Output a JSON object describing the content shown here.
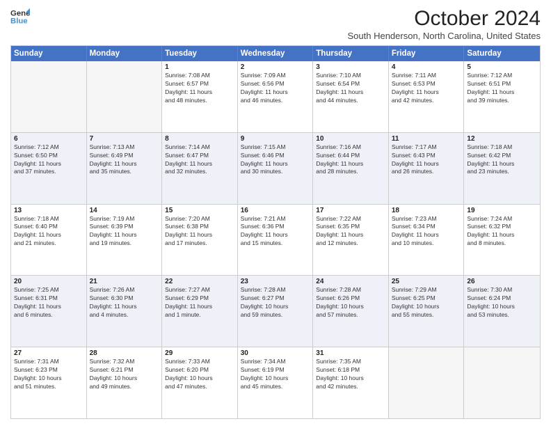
{
  "logo": {
    "line1": "General",
    "line2": "Blue"
  },
  "title": "October 2024",
  "subtitle": "South Henderson, North Carolina, United States",
  "header_days": [
    "Sunday",
    "Monday",
    "Tuesday",
    "Wednesday",
    "Thursday",
    "Friday",
    "Saturday"
  ],
  "rows": [
    {
      "alt": false,
      "cells": [
        {
          "day": "",
          "lines": []
        },
        {
          "day": "",
          "lines": []
        },
        {
          "day": "1",
          "lines": [
            "Sunrise: 7:08 AM",
            "Sunset: 6:57 PM",
            "Daylight: 11 hours",
            "and 48 minutes."
          ]
        },
        {
          "day": "2",
          "lines": [
            "Sunrise: 7:09 AM",
            "Sunset: 6:56 PM",
            "Daylight: 11 hours",
            "and 46 minutes."
          ]
        },
        {
          "day": "3",
          "lines": [
            "Sunrise: 7:10 AM",
            "Sunset: 6:54 PM",
            "Daylight: 11 hours",
            "and 44 minutes."
          ]
        },
        {
          "day": "4",
          "lines": [
            "Sunrise: 7:11 AM",
            "Sunset: 6:53 PM",
            "Daylight: 11 hours",
            "and 42 minutes."
          ]
        },
        {
          "day": "5",
          "lines": [
            "Sunrise: 7:12 AM",
            "Sunset: 6:51 PM",
            "Daylight: 11 hours",
            "and 39 minutes."
          ]
        }
      ]
    },
    {
      "alt": true,
      "cells": [
        {
          "day": "6",
          "lines": [
            "Sunrise: 7:12 AM",
            "Sunset: 6:50 PM",
            "Daylight: 11 hours",
            "and 37 minutes."
          ]
        },
        {
          "day": "7",
          "lines": [
            "Sunrise: 7:13 AM",
            "Sunset: 6:49 PM",
            "Daylight: 11 hours",
            "and 35 minutes."
          ]
        },
        {
          "day": "8",
          "lines": [
            "Sunrise: 7:14 AM",
            "Sunset: 6:47 PM",
            "Daylight: 11 hours",
            "and 32 minutes."
          ]
        },
        {
          "day": "9",
          "lines": [
            "Sunrise: 7:15 AM",
            "Sunset: 6:46 PM",
            "Daylight: 11 hours",
            "and 30 minutes."
          ]
        },
        {
          "day": "10",
          "lines": [
            "Sunrise: 7:16 AM",
            "Sunset: 6:44 PM",
            "Daylight: 11 hours",
            "and 28 minutes."
          ]
        },
        {
          "day": "11",
          "lines": [
            "Sunrise: 7:17 AM",
            "Sunset: 6:43 PM",
            "Daylight: 11 hours",
            "and 26 minutes."
          ]
        },
        {
          "day": "12",
          "lines": [
            "Sunrise: 7:18 AM",
            "Sunset: 6:42 PM",
            "Daylight: 11 hours",
            "and 23 minutes."
          ]
        }
      ]
    },
    {
      "alt": false,
      "cells": [
        {
          "day": "13",
          "lines": [
            "Sunrise: 7:18 AM",
            "Sunset: 6:40 PM",
            "Daylight: 11 hours",
            "and 21 minutes."
          ]
        },
        {
          "day": "14",
          "lines": [
            "Sunrise: 7:19 AM",
            "Sunset: 6:39 PM",
            "Daylight: 11 hours",
            "and 19 minutes."
          ]
        },
        {
          "day": "15",
          "lines": [
            "Sunrise: 7:20 AM",
            "Sunset: 6:38 PM",
            "Daylight: 11 hours",
            "and 17 minutes."
          ]
        },
        {
          "day": "16",
          "lines": [
            "Sunrise: 7:21 AM",
            "Sunset: 6:36 PM",
            "Daylight: 11 hours",
            "and 15 minutes."
          ]
        },
        {
          "day": "17",
          "lines": [
            "Sunrise: 7:22 AM",
            "Sunset: 6:35 PM",
            "Daylight: 11 hours",
            "and 12 minutes."
          ]
        },
        {
          "day": "18",
          "lines": [
            "Sunrise: 7:23 AM",
            "Sunset: 6:34 PM",
            "Daylight: 11 hours",
            "and 10 minutes."
          ]
        },
        {
          "day": "19",
          "lines": [
            "Sunrise: 7:24 AM",
            "Sunset: 6:32 PM",
            "Daylight: 11 hours",
            "and 8 minutes."
          ]
        }
      ]
    },
    {
      "alt": true,
      "cells": [
        {
          "day": "20",
          "lines": [
            "Sunrise: 7:25 AM",
            "Sunset: 6:31 PM",
            "Daylight: 11 hours",
            "and 6 minutes."
          ]
        },
        {
          "day": "21",
          "lines": [
            "Sunrise: 7:26 AM",
            "Sunset: 6:30 PM",
            "Daylight: 11 hours",
            "and 4 minutes."
          ]
        },
        {
          "day": "22",
          "lines": [
            "Sunrise: 7:27 AM",
            "Sunset: 6:29 PM",
            "Daylight: 11 hours",
            "and 1 minute."
          ]
        },
        {
          "day": "23",
          "lines": [
            "Sunrise: 7:28 AM",
            "Sunset: 6:27 PM",
            "Daylight: 10 hours",
            "and 59 minutes."
          ]
        },
        {
          "day": "24",
          "lines": [
            "Sunrise: 7:28 AM",
            "Sunset: 6:26 PM",
            "Daylight: 10 hours",
            "and 57 minutes."
          ]
        },
        {
          "day": "25",
          "lines": [
            "Sunrise: 7:29 AM",
            "Sunset: 6:25 PM",
            "Daylight: 10 hours",
            "and 55 minutes."
          ]
        },
        {
          "day": "26",
          "lines": [
            "Sunrise: 7:30 AM",
            "Sunset: 6:24 PM",
            "Daylight: 10 hours",
            "and 53 minutes."
          ]
        }
      ]
    },
    {
      "alt": false,
      "cells": [
        {
          "day": "27",
          "lines": [
            "Sunrise: 7:31 AM",
            "Sunset: 6:23 PM",
            "Daylight: 10 hours",
            "and 51 minutes."
          ]
        },
        {
          "day": "28",
          "lines": [
            "Sunrise: 7:32 AM",
            "Sunset: 6:21 PM",
            "Daylight: 10 hours",
            "and 49 minutes."
          ]
        },
        {
          "day": "29",
          "lines": [
            "Sunrise: 7:33 AM",
            "Sunset: 6:20 PM",
            "Daylight: 10 hours",
            "and 47 minutes."
          ]
        },
        {
          "day": "30",
          "lines": [
            "Sunrise: 7:34 AM",
            "Sunset: 6:19 PM",
            "Daylight: 10 hours",
            "and 45 minutes."
          ]
        },
        {
          "day": "31",
          "lines": [
            "Sunrise: 7:35 AM",
            "Sunset: 6:18 PM",
            "Daylight: 10 hours",
            "and 42 minutes."
          ]
        },
        {
          "day": "",
          "lines": []
        },
        {
          "day": "",
          "lines": []
        }
      ]
    }
  ]
}
